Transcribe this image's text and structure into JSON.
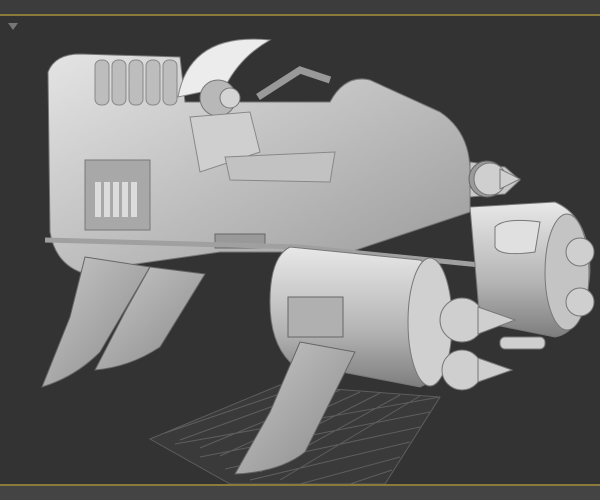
{
  "viewport": {
    "menu_icon": "viewport-menu-triangle-icon",
    "colors": {
      "background": "#333333",
      "active_border": "#8a7a3c",
      "grid": "#6a6a6a",
      "model_light": "#d8d8d8",
      "model_shadow": "#8c8c8c"
    }
  }
}
